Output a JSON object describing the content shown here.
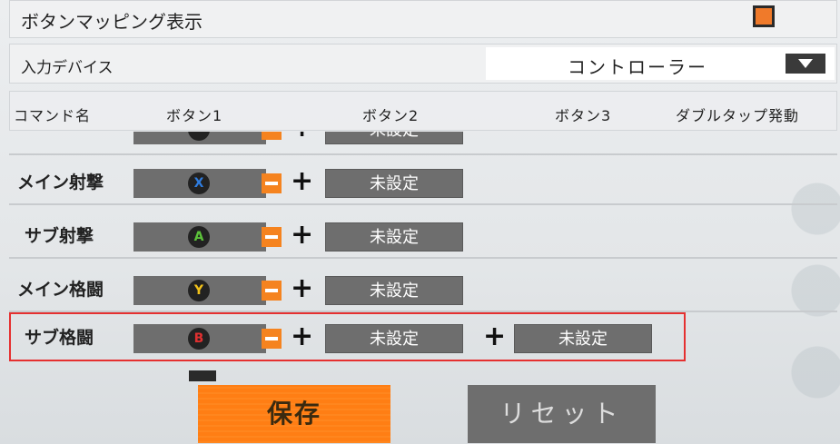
{
  "settings": {
    "button_mapping_label": "ボタンマッピング表示",
    "input_device_label": "入力デバイス",
    "input_device_value": "コントローラー"
  },
  "table_header": {
    "command": "コマンド名",
    "button1": "ボタン1",
    "button2": "ボタン2",
    "button3": "ボタン3",
    "double_tap": "ダブルタップ発動"
  },
  "rows": [
    {
      "command": "",
      "pad": "",
      "pad_color": "#222222",
      "button2": "未設定"
    },
    {
      "command": "メイン射撃",
      "pad": "X",
      "pad_color": "#2f7de0",
      "button2": "未設定"
    },
    {
      "command": "サブ射撃",
      "pad": "A",
      "pad_color": "#5cc23a",
      "button2": "未設定"
    },
    {
      "command": "メイン格闘",
      "pad": "Y",
      "pad_color": "#f2c21a",
      "button2": "未設定"
    },
    {
      "command": "サブ格闘",
      "pad": "B",
      "pad_color": "#e03030",
      "button2": "未設定",
      "button3": "未設定"
    }
  ],
  "plus_symbol": "+",
  "buttons": {
    "save": "保存",
    "reset": "リセット"
  },
  "colors": {
    "accent_orange": "#f5831f",
    "highlight_red": "#e53030",
    "slot_gray": "#6e6e6e"
  }
}
